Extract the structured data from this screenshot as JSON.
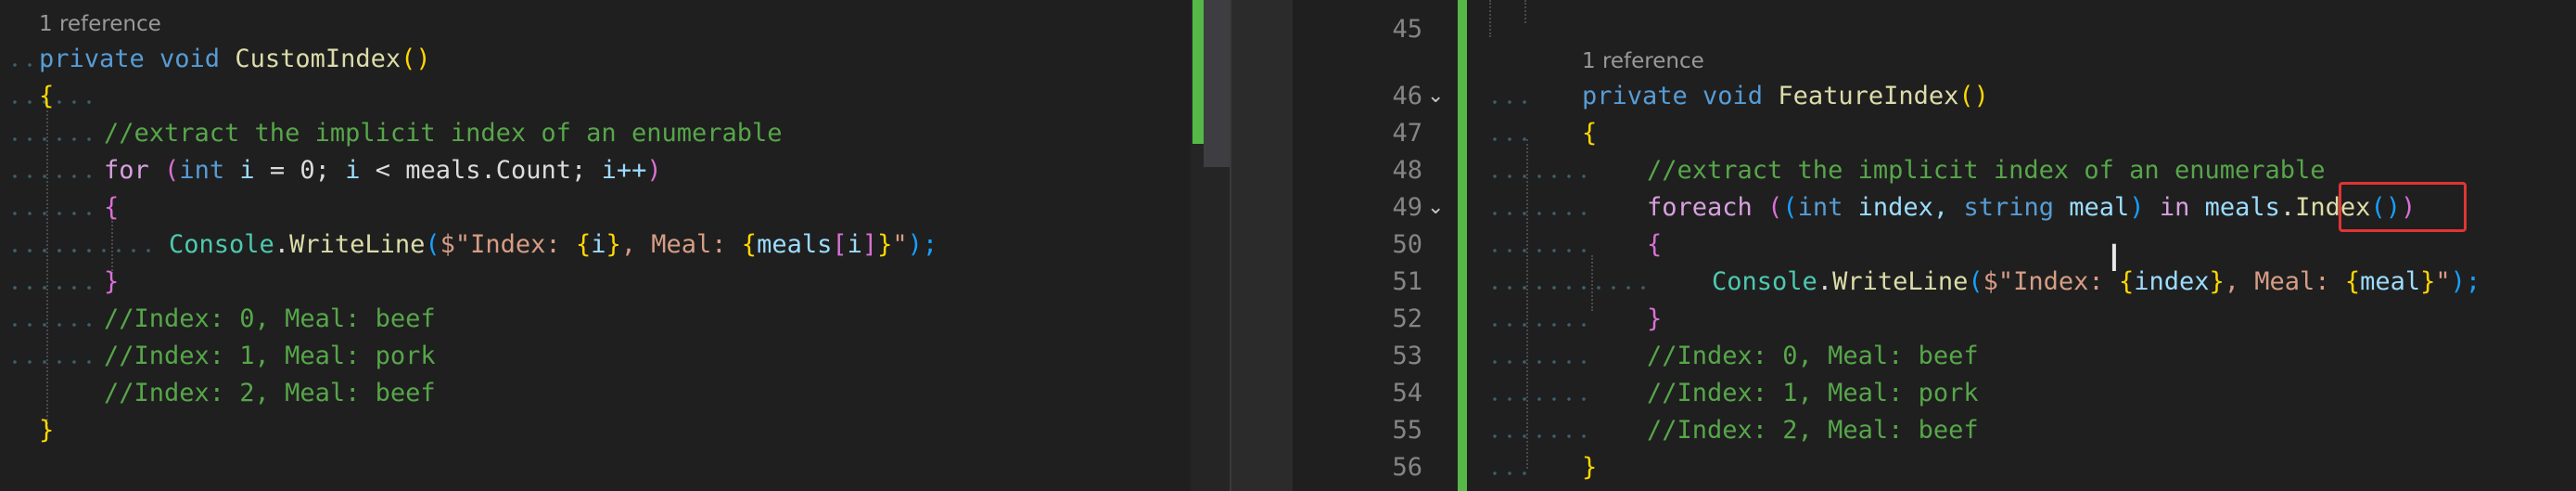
{
  "left_editor": {
    "codelens": "1 reference",
    "method_signature": {
      "modifiers": "private void",
      "name": "CustomIndex",
      "parens": "()"
    },
    "open_brace": "{",
    "comment_header": "//extract the implicit index of an enumerable",
    "for_line": {
      "keyword": "for",
      "open": "(",
      "int_kw": "int",
      "var_i": "i",
      "init": "= 0;",
      "var_i2": "i",
      "cond": "< meals.Count;",
      "incr": "i++",
      "close": ")"
    },
    "inner_open_brace": "{",
    "write_line": {
      "class": "Console",
      "dot": ".",
      "method": "WriteLine",
      "open": "(",
      "str_start": "$\"Index: ",
      "interp_i_open": "{",
      "interp_i": "i",
      "interp_i_close": "}",
      "str_mid": ", Meal: ",
      "interp_m_open": "{",
      "interp_m": "meals",
      "bracket_open": "[",
      "bracket_i": "i",
      "bracket_close": "]",
      "interp_m_close": "}",
      "str_end": "\"",
      "close": ");"
    },
    "inner_close_brace": "}",
    "output_comments": [
      "//Index: 0, Meal: beef",
      "//Index: 1, Meal: pork",
      "//Index: 2, Meal: beef"
    ],
    "close_brace": "}"
  },
  "right_editor": {
    "line_numbers": [
      "45",
      "46",
      "47",
      "48",
      "49",
      "50",
      "51",
      "52",
      "53",
      "54",
      "55",
      "56"
    ],
    "codelens": "1 reference",
    "method_signature": {
      "modifiers": "private void",
      "name": "FeatureIndex",
      "parens": "()"
    },
    "open_brace": "{",
    "comment_header": "//extract the implicit index of an enumerable",
    "foreach_line": {
      "keyword": "foreach",
      "open_outer": "(",
      "open_tuple": "(",
      "int_kw": "int",
      "var_index": "index,",
      "string_kw": "string",
      "var_meal": "meal",
      "close_tuple": ")",
      "in_kw": "in",
      "collection": "meals",
      "dot": ".",
      "method": "Index",
      "method_parens": "()",
      "close_outer": ")"
    },
    "inner_open_brace": "{",
    "write_line": {
      "class": "Console",
      "dot": ".",
      "method": "WriteLine",
      "open": "(",
      "str_start": "$\"Index: ",
      "interp_idx_open": "{",
      "interp_idx": "index",
      "interp_idx_close": "}",
      "str_mid": ", Meal: ",
      "interp_meal_open": "{",
      "interp_meal": "meal",
      "interp_meal_close": "}",
      "str_end": "\"",
      "close": ");"
    },
    "inner_close_brace": "}",
    "output_comments": [
      "//Index: 0, Meal: beef",
      "//Index: 1, Meal: pork",
      "//Index: 2, Meal: beef"
    ],
    "close_brace": "}",
    "fold_glyph": "⌄",
    "cursor_glyph": "I"
  },
  "colors": {
    "keyword": "#569cd6",
    "control": "#d8a0df",
    "type": "#4ec9b0",
    "method": "#dcdcaa",
    "variable": "#9cdcfe",
    "string": "#d69d85",
    "comment": "#57a64a",
    "change_bar": "#56b847",
    "highlight_box": "#e03434"
  }
}
